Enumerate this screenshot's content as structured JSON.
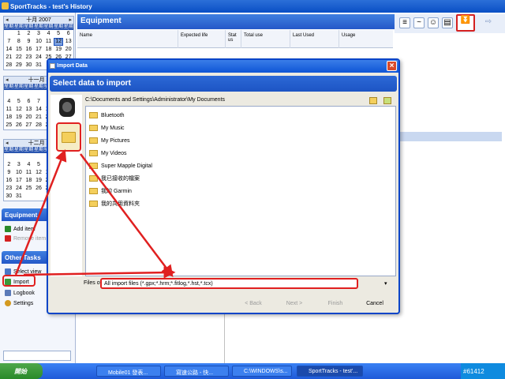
{
  "window": {
    "title": "SportTracks - test's History"
  },
  "calendar": {
    "weekday_headers": [
      "星期日",
      "星期一",
      "星期二",
      "星期三",
      "星期四",
      "星期五",
      "星期六"
    ],
    "months": [
      {
        "label": "十月 2007",
        "days": [
          " ",
          "1",
          "2",
          "3",
          "4",
          "5",
          "6",
          "7",
          "8",
          "9",
          "10",
          "11",
          "12",
          "13",
          "14",
          "15",
          "16",
          "17",
          "18",
          "19",
          "20",
          "21",
          "22",
          "23",
          "24",
          "25",
          "26",
          "27",
          "28",
          "29",
          "30",
          "31",
          " ",
          " ",
          " "
        ],
        "selected": "12"
      },
      {
        "label": "十一月 2",
        "days": [
          " ",
          " ",
          " ",
          " ",
          "1",
          "2",
          "3",
          "4",
          "5",
          "6",
          "7",
          "8",
          "9",
          "10",
          "11",
          "12",
          "13",
          "14",
          "15",
          "16",
          "17",
          "18",
          "19",
          "20",
          "21",
          "22",
          "23",
          "24",
          "25",
          "26",
          "27",
          "28",
          "29",
          "30",
          " "
        ]
      },
      {
        "label": "十二月 2",
        "days": [
          " ",
          " ",
          " ",
          " ",
          " ",
          " ",
          "1",
          "2",
          "3",
          "4",
          "5",
          "6",
          "7",
          "8",
          "9",
          "10",
          "11",
          "12",
          "13",
          "14",
          "15",
          "16",
          "17",
          "18",
          "19",
          "20",
          "21",
          "22",
          "23",
          "24",
          "25",
          "26",
          "27",
          "28",
          "29",
          "30",
          "31",
          " ",
          " ",
          " ",
          " ",
          " "
        ]
      }
    ]
  },
  "equipment_section": {
    "title": "Equipment",
    "tasks": [
      {
        "label": "Add item",
        "icon": "add-icon",
        "color": "#2a8a2a"
      },
      {
        "label": "Remove item",
        "icon": "remove-icon",
        "color": "#d42020"
      }
    ]
  },
  "other_tasks": {
    "title": "Other Tasks",
    "tasks": [
      {
        "label": "Select view",
        "icon": "view-icon"
      },
      {
        "label": "Import",
        "icon": "import-icon"
      },
      {
        "label": "Logbook",
        "icon": "logbook-icon"
      },
      {
        "label": "Settings",
        "icon": "settings-icon"
      }
    ]
  },
  "main": {
    "header": "Equipment",
    "columns": [
      "Name",
      "Expected life",
      "Stat us",
      "Total use",
      "Last Used",
      "Usage"
    ]
  },
  "dialog": {
    "title": "Import Data",
    "banner": "Select data to import",
    "path": "C:\\Documents and Settings\\Administrator\\My Documents",
    "files": [
      "Bluetooth",
      "My Music",
      "My Pictures",
      "My Videos",
      "Super Mapple Digital",
      "我已接收的檔案",
      "我的 Garmin",
      "我的共用資料夾"
    ],
    "files_of_type_label": "Files of type:",
    "files_of_type_value": "All import files (*.gpx;*.hrm;*.fitlog,*.hst,*.tcx)",
    "buttons": {
      "back": "< Back",
      "next": "Next >",
      "finish": "Finish",
      "cancel": "Cancel"
    }
  },
  "taskbar": {
    "start": "開始",
    "items": [
      "Mobile01 發表...",
      "寫速公路 - 快...",
      "C:\\WINDOWS\\s...",
      "SportTracks - test'..."
    ],
    "tray_text": "#61412"
  },
  "colors": {
    "accent": "#2458c8",
    "annotation": "#e02020"
  }
}
